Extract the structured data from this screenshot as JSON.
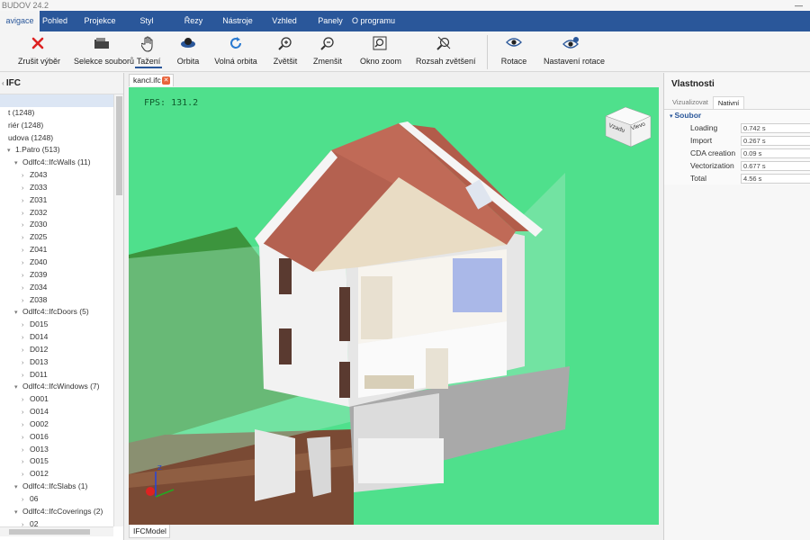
{
  "window": {
    "title": "BUDOV 24.2",
    "close_glyph": "—"
  },
  "menu": [
    {
      "label": "avigace",
      "active": true
    },
    {
      "label": "Pohled"
    },
    {
      "label": "Projekce"
    },
    {
      "label": "Styl"
    },
    {
      "label": "Řezy"
    },
    {
      "label": "Nástroje"
    },
    {
      "label": "Vzhled"
    },
    {
      "label": "Panely"
    },
    {
      "label": "O programu"
    }
  ],
  "toolbar": {
    "zrusit": {
      "label": "Zrušit výběr",
      "icon": "x-icon"
    },
    "selekce": {
      "label": "Selekce souborů",
      "icon": "folder-icon"
    },
    "tazeni": {
      "label": "Tažení",
      "icon": "hand-icon"
    },
    "orbita": {
      "label": "Orbita",
      "icon": "orbit-icon"
    },
    "volna": {
      "label": "Volná orbita",
      "icon": "free-orbit-icon"
    },
    "zvetsit": {
      "label": "Zvětšit",
      "icon": "zoom-in-icon"
    },
    "zmensit": {
      "label": "Zmenšit",
      "icon": "zoom-out-icon"
    },
    "okno": {
      "label": "Okno zoom",
      "icon": "zoom-window-icon"
    },
    "rozsah": {
      "label": "Rozsah zvětšení",
      "icon": "zoom-extents-icon"
    },
    "rotace": {
      "label": "Rotace",
      "icon": "eye-icon"
    },
    "nastaveni": {
      "label": "Nastavení rotace",
      "icon": "eye-settings-icon"
    }
  },
  "left_panel": {
    "title": "IFC",
    "tree": [
      {
        "label": "",
        "indent": 0,
        "selected": true
      },
      {
        "label": "t (1248)",
        "indent": 0
      },
      {
        "label": "riér (1248)",
        "indent": 0
      },
      {
        "label": "udova (1248)",
        "indent": 0
      },
      {
        "label": "1.Patro (513)",
        "indent": 1,
        "chev": "▾"
      },
      {
        "label": "Odlfc4::IfcWalls (11)",
        "indent": 2,
        "chev": "▾"
      },
      {
        "label": "Z043",
        "indent": 3,
        "chev": "›"
      },
      {
        "label": "Z033",
        "indent": 3,
        "chev": "›"
      },
      {
        "label": "Z031",
        "indent": 3,
        "chev": "›"
      },
      {
        "label": "Z032",
        "indent": 3,
        "chev": "›"
      },
      {
        "label": "Z030",
        "indent": 3,
        "chev": "›"
      },
      {
        "label": "Z025",
        "indent": 3,
        "chev": "›"
      },
      {
        "label": "Z041",
        "indent": 3,
        "chev": "›"
      },
      {
        "label": "Z040",
        "indent": 3,
        "chev": "›"
      },
      {
        "label": "Z039",
        "indent": 3,
        "chev": "›"
      },
      {
        "label": "Z034",
        "indent": 3,
        "chev": "›"
      },
      {
        "label": "Z038",
        "indent": 3,
        "chev": "›"
      },
      {
        "label": "Odlfc4::IfcDoors (5)",
        "indent": 2,
        "chev": "▾"
      },
      {
        "label": "D015",
        "indent": 3,
        "chev": "›"
      },
      {
        "label": "D014",
        "indent": 3,
        "chev": "›"
      },
      {
        "label": "D012",
        "indent": 3,
        "chev": "›"
      },
      {
        "label": "D013",
        "indent": 3,
        "chev": "›"
      },
      {
        "label": "D011",
        "indent": 3,
        "chev": "›"
      },
      {
        "label": "Odlfc4::IfcWindows (7)",
        "indent": 2,
        "chev": "▾"
      },
      {
        "label": "O001",
        "indent": 3,
        "chev": "›"
      },
      {
        "label": "O014",
        "indent": 3,
        "chev": "›"
      },
      {
        "label": "O002",
        "indent": 3,
        "chev": "›"
      },
      {
        "label": "O016",
        "indent": 3,
        "chev": "›"
      },
      {
        "label": "O013",
        "indent": 3,
        "chev": "›"
      },
      {
        "label": "O015",
        "indent": 3,
        "chev": "›"
      },
      {
        "label": "O012",
        "indent": 3,
        "chev": "›"
      },
      {
        "label": "Odlfc4::IfcSlabs (1)",
        "indent": 2,
        "chev": "▾"
      },
      {
        "label": "06",
        "indent": 3,
        "chev": "›"
      },
      {
        "label": "Odlfc4::IfcCoverings (2)",
        "indent": 2,
        "chev": "▾"
      },
      {
        "label": "02",
        "indent": 3,
        "chev": "›"
      }
    ]
  },
  "viewport": {
    "file_tab": "kancl.ifc",
    "fps_text": "FPS: 131.2",
    "bottom_tab": "IFCModel",
    "viewcube": {
      "top": "Shora",
      "front": "Vzadu",
      "right": "Vlevo"
    },
    "background": "#4fe08c"
  },
  "right_panel": {
    "title": "Vlastnosti",
    "tabs": [
      {
        "label": "Vizualizovat"
      },
      {
        "label": "Nativní",
        "active": true
      }
    ],
    "section": "Soubor",
    "props": [
      {
        "key": "Loading",
        "value": "0.742 s"
      },
      {
        "key": "Import",
        "value": "0.267 s"
      },
      {
        "key": "CDA creation",
        "value": "0.09 s"
      },
      {
        "key": "Vectorization",
        "value": "0.677 s"
      },
      {
        "key": "Total",
        "value": "4.56 s"
      }
    ]
  },
  "colors": {
    "accent": "#2a579a",
    "roof": "#b46150",
    "ground": "#3a8a38",
    "soil": "#8a5a40"
  }
}
